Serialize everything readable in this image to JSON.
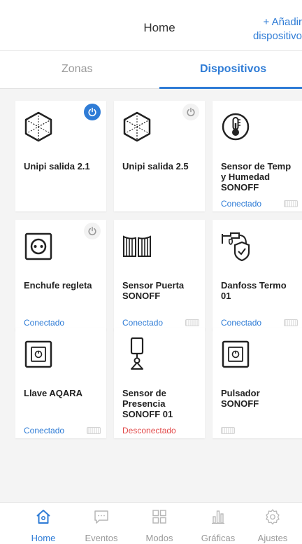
{
  "header": {
    "title": "Home",
    "add_line1": "+ Añadir",
    "add_line2": "dispositivo"
  },
  "tabs": [
    {
      "label": "Zonas"
    },
    {
      "label": "Dispositivos"
    }
  ],
  "devices": [
    {
      "name": "Unipi salida 2.1",
      "icon": "cube-icon",
      "status": "",
      "power": "on"
    },
    {
      "name": "Unipi salida 2.5",
      "icon": "cube-icon",
      "status": "",
      "power": "off"
    },
    {
      "name": "Sensor de Temp y Humedad SONOFF",
      "icon": "thermometer-icon",
      "status": "Conectado"
    },
    {
      "name": "Enchufe regleta",
      "icon": "socket-icon",
      "status": "Conectado",
      "power": "off"
    },
    {
      "name": "Sensor Puerta SONOFF",
      "icon": "gate-icon",
      "status": "Conectado"
    },
    {
      "name": "Danfoss Termo 01",
      "icon": "valve-shield-icon",
      "status": "Conectado"
    },
    {
      "name": "Llave AQARA",
      "icon": "wall-switch-icon",
      "status": "Conectado"
    },
    {
      "name": "Sensor de Presencia SONOFF 01",
      "icon": "presence-sensor-icon",
      "status": "Desconectado"
    },
    {
      "name": "Pulsador SONOFF",
      "icon": "wall-switch-icon",
      "status": ""
    }
  ],
  "nav": [
    {
      "label": "Home",
      "icon": "home-icon"
    },
    {
      "label": "Eventos",
      "icon": "chat-icon"
    },
    {
      "label": "Modos",
      "icon": "grid-icon"
    },
    {
      "label": "Gráficas",
      "icon": "bar-chart-icon"
    },
    {
      "label": "Ajustes",
      "icon": "gear-icon"
    }
  ],
  "colors": {
    "accent": "#2f7cd6",
    "error": "#e24a4a",
    "muted": "#9a9a9a"
  }
}
